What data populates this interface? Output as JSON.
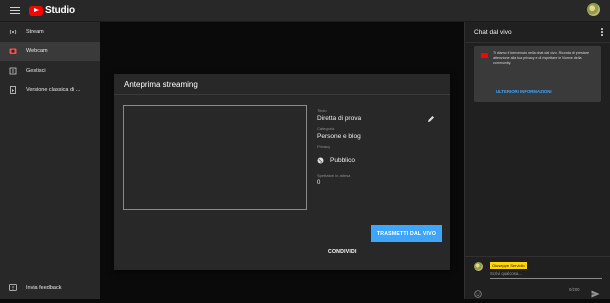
{
  "app": {
    "title": "Studio"
  },
  "sidebar": {
    "items": [
      {
        "label": "Stream",
        "icon": "stream-icon"
      },
      {
        "label": "Webcam",
        "icon": "webcam-icon"
      },
      {
        "label": "Gestisci",
        "icon": "manage-icon"
      },
      {
        "label": "Versione classica di ...",
        "icon": "classic-icon"
      }
    ],
    "feedback_label": "Invia feedback"
  },
  "dialog": {
    "title": "Anteprima streaming",
    "title_label": "Titolo",
    "title_value": "Diretta di prova",
    "category_label": "Categoria",
    "category_value": "Persone e blog",
    "privacy_label": "Privacy",
    "privacy_value": "Pubblico",
    "viewers_label": "Spettatori in attesa",
    "viewers_value": "0",
    "share_button": "CONDIVIDI",
    "live_button": "TRASMETTI DAL VIVO"
  },
  "chat": {
    "title": "Chat dal vivo",
    "welcome_text": "Ti diamo il benvenuto nella chat dal vivo. Ricorda di prestare attenzione alla tua privacy e di rispettare le Norme della community.",
    "learn_more": "ULTERIORI INFORMAZIONI",
    "user_name": "Giuseppe Servidio",
    "input_placeholder": "Scrivi qualcosa...",
    "counter": "0/200"
  },
  "colors": {
    "accent": "#3ea6ff",
    "brand": "#ff0000",
    "highlight": "#ffd600"
  }
}
